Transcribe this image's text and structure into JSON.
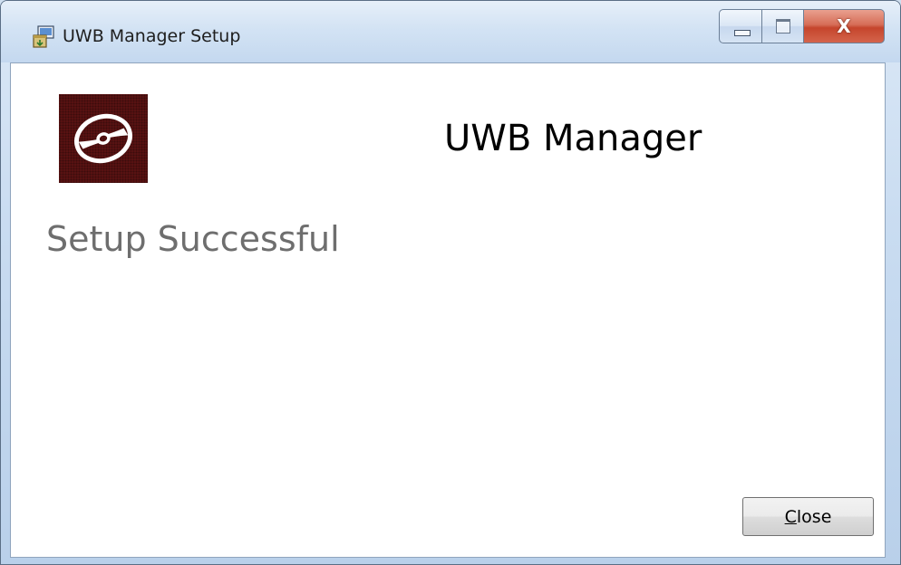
{
  "window": {
    "title": "UWB Manager Setup",
    "icon": "installer-package-icon",
    "caption_buttons": {
      "minimize_icon": "minimize-icon",
      "maximize_icon": "maximize-icon",
      "close_label": "X"
    }
  },
  "main": {
    "product_name": "UWB Manager",
    "logo_icon": "disc-icon",
    "status": "Setup Successful"
  },
  "footer": {
    "close_button": {
      "mnemonic": "C",
      "rest": "lose"
    }
  },
  "colors": {
    "logo_background": "#5a1212",
    "close_caption_red": "#c5452c",
    "status_text": "#6e6e6e"
  }
}
